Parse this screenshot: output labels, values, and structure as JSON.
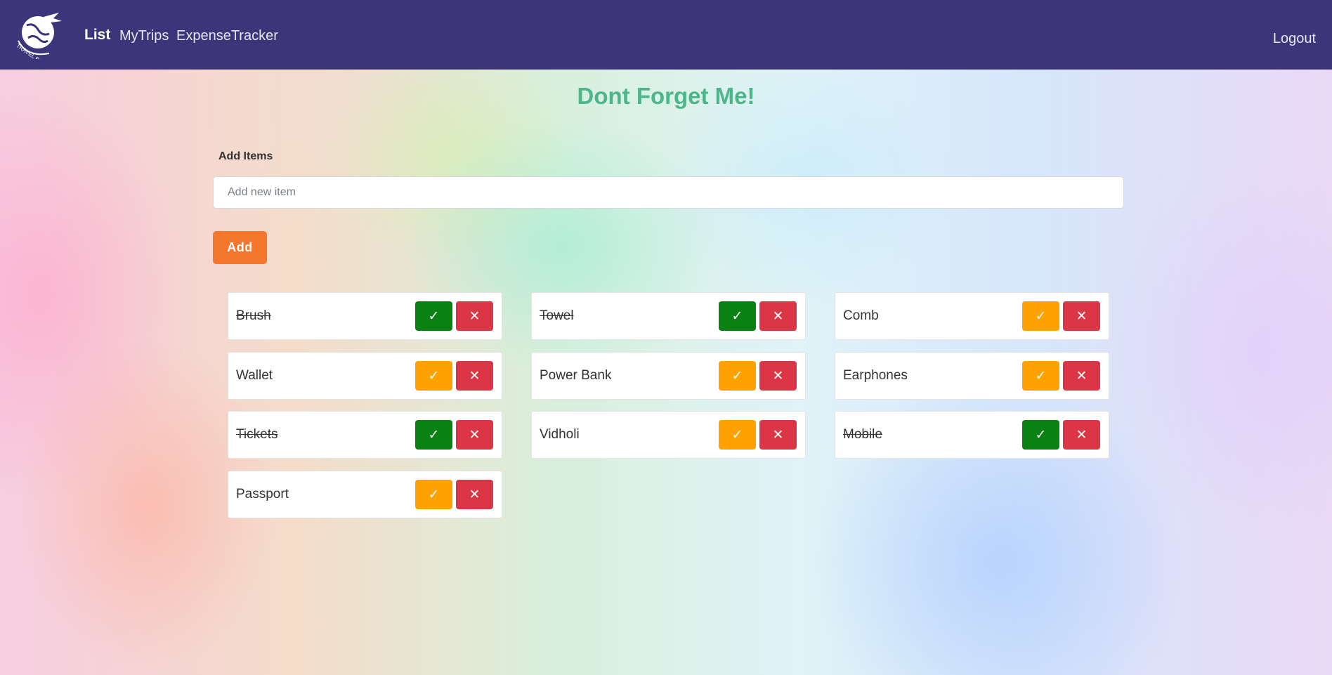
{
  "nav": {
    "logo_alt": "TRAVEL BUDDY",
    "links": [
      "List",
      "MyTrips",
      "ExpenseTracker"
    ],
    "logout": "Logout"
  },
  "page": {
    "title": "Dont Forget Me!",
    "add_label": "Add Items",
    "input_placeholder": "Add new item",
    "input_value": "",
    "add_button": "Add"
  },
  "icons": {
    "check": "✓",
    "remove": "✕"
  },
  "colors": {
    "navbar": "#3d3579",
    "title": "#4cb58a",
    "add_button": "#f5772d",
    "checked": "#0a8113",
    "unchecked": "#ffa200",
    "remove": "#dc3545"
  },
  "items": [
    {
      "name": "Brush",
      "done": true
    },
    {
      "name": "Towel",
      "done": true
    },
    {
      "name": "Comb",
      "done": false
    },
    {
      "name": "Wallet",
      "done": false
    },
    {
      "name": "Power Bank",
      "done": false
    },
    {
      "name": "Earphones",
      "done": false
    },
    {
      "name": "Tickets",
      "done": true
    },
    {
      "name": "Vidholi",
      "done": false
    },
    {
      "name": "Mobile",
      "done": true
    },
    {
      "name": "Passport",
      "done": false
    }
  ]
}
